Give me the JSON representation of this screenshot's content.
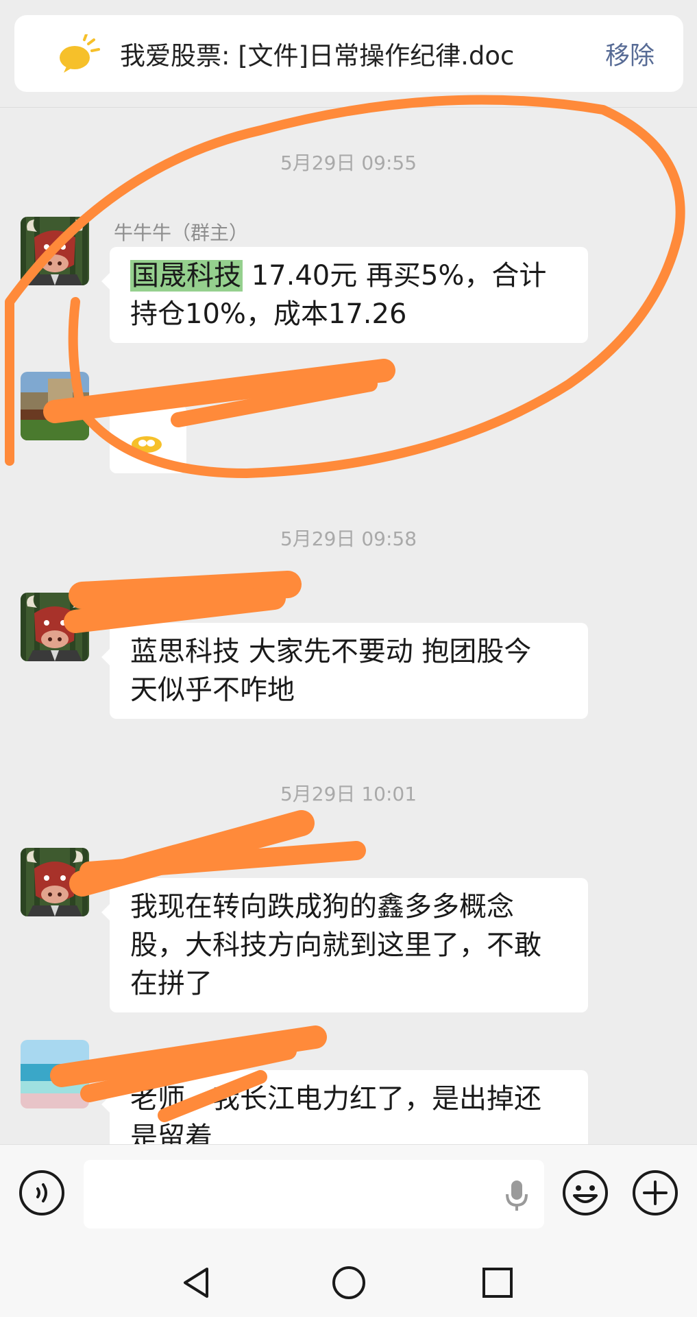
{
  "pinned": {
    "text": "我爱股票: [文件]日常操作纪律.doc",
    "remove_label": "移除",
    "icon": "yellow-chat-bubble-icon"
  },
  "messages": [
    {
      "time": "5月29日 09:55",
      "sender": "牛牛牛（群主）",
      "highlight": "国晟科技",
      "line1_rest": " 17.40元 再买5%，合计",
      "line2": "持仓10%，成本17.26",
      "avatar": "bull-avatar"
    },
    {
      "avatar": "landscape-avatar",
      "content": "emoji-reply"
    },
    {
      "time": "5月29日 09:58",
      "avatar": "bull-avatar",
      "line1": "蓝思科技  大家先不要动  抱团股今",
      "line2": "天似乎不咋地"
    },
    {
      "time": "5月29日 10:01",
      "avatar": "bull-avatar",
      "line1": "我现在转向跌成狗的鑫多多概念",
      "line2": "股，大科技方向就到这里了，不敢",
      "line3": "在拼了"
    },
    {
      "avatar": "beach-avatar",
      "line1": "老师，我长江电力红了，是出掉还",
      "line2": "是留着"
    }
  ],
  "colors": {
    "background": "#ededed",
    "highlight": "#95d08e",
    "annotation": "#ff8a3a",
    "link": "#576b95"
  }
}
